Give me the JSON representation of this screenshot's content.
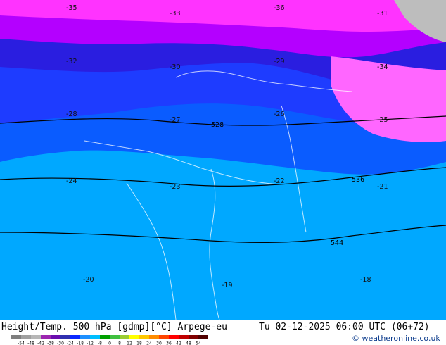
{
  "map": {
    "field": "Height/Temp. 500 hPa",
    "geopotential_labels": [
      "528",
      "536",
      "544"
    ],
    "temperature_labels": [
      {
        "t": -35,
        "row": 0
      },
      {
        "t": -33,
        "row": 0
      },
      {
        "t": -36,
        "row": 0
      },
      {
        "t": -31,
        "row": 0
      },
      {
        "t": -32,
        "row": 1
      },
      {
        "t": -30,
        "row": 1
      },
      {
        "t": -29,
        "row": 1
      },
      {
        "t": -34,
        "row": 1
      },
      {
        "t": -28,
        "row": 2
      },
      {
        "t": -27,
        "row": 2
      },
      {
        "t": -26,
        "row": 2
      },
      {
        "t": -25,
        "row": 2
      },
      {
        "t": -24,
        "row": 3
      },
      {
        "t": -23,
        "row": 3
      },
      {
        "t": -22,
        "row": 3
      },
      {
        "t": -21,
        "row": 3
      },
      {
        "t": -20,
        "row": 4
      },
      {
        "t": -19,
        "row": 4
      },
      {
        "t": -18,
        "row": 4
      }
    ]
  },
  "footer": {
    "title": "Height/Temp. 500 hPa [gdmp][°C] Arpege-eu",
    "datetime": "Tu 02-12-2025 06:00 UTC (06+72)",
    "credit": "© weatheronline.co.uk"
  },
  "scale": {
    "ticks": [
      "-54",
      "-48",
      "-42",
      "-38",
      "-30",
      "-24",
      "-18",
      "-12",
      "-8",
      "0",
      "8",
      "12",
      "18",
      "24",
      "30",
      "36",
      "42",
      "48",
      "54"
    ],
    "colors": [
      "#7f7f7f",
      "#a0a0a0",
      "#b7b7b7",
      "#9c27b0",
      "#6a0dad",
      "#3030b0",
      "#0a28ff",
      "#1e90ff",
      "#00bfff",
      "#00a000",
      "#40c040",
      "#9acd32",
      "#ffff00",
      "#ffc800",
      "#ff8c00",
      "#ff4500",
      "#ff0000",
      "#c00000",
      "#800000",
      "#500000"
    ]
  }
}
